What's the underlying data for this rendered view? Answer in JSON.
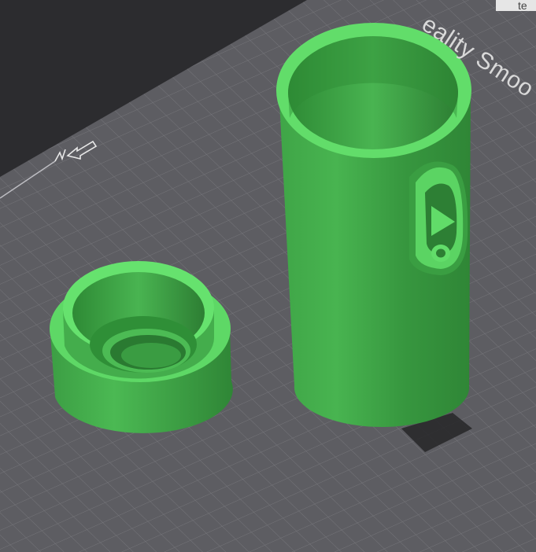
{
  "bed": {
    "label": "eality Smoo",
    "tag": "te"
  },
  "colors": {
    "background": "#2f2f32",
    "bed": "#5f5f64",
    "grid_line": "#77777c",
    "model_green": "#3fa847",
    "model_green_light": "#63e06c",
    "model_green_dark": "#2c7a33"
  },
  "icons": {
    "bed_marker": "origin-marker-icon"
  }
}
